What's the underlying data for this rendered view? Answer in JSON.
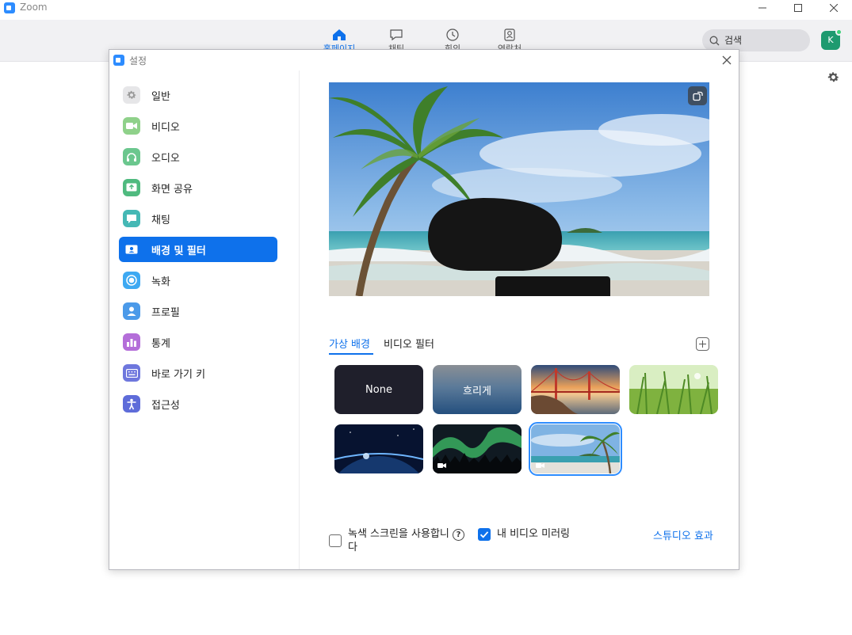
{
  "app": {
    "title": "Zoom"
  },
  "topnav": {
    "tabs": [
      {
        "label": "홈페이지",
        "icon": "home-icon",
        "active": true
      },
      {
        "label": "채팅",
        "icon": "chat-icon",
        "active": false
      },
      {
        "label": "회의",
        "icon": "clock-icon",
        "active": false
      },
      {
        "label": "연락처",
        "icon": "contacts-icon",
        "active": false
      }
    ],
    "search_placeholder": "검색",
    "avatar_initial": "K"
  },
  "settings": {
    "title": "설정",
    "sidebar": [
      {
        "label": "일반",
        "icon": "gear-icon",
        "color": "#9e9e9e"
      },
      {
        "label": "비디오",
        "icon": "video-camera-icon",
        "color": "#7cc576"
      },
      {
        "label": "오디오",
        "icon": "headphones-icon",
        "color": "#66c088"
      },
      {
        "label": "화면 공유",
        "icon": "share-screen-icon",
        "color": "#46b37b"
      },
      {
        "label": "채팅",
        "icon": "chat-bubble-icon",
        "color": "#3fb6b3"
      },
      {
        "label": "배경 및 필터",
        "icon": "person-card-icon",
        "color": "#0e71eb",
        "active": true
      },
      {
        "label": "녹화",
        "icon": "record-icon",
        "color": "#3da7ef"
      },
      {
        "label": "프로필",
        "icon": "profile-icon",
        "color": "#4a98e8"
      },
      {
        "label": "통계",
        "icon": "bar-chart-icon",
        "color": "#b06bd6"
      },
      {
        "label": "바로 가기 키",
        "icon": "keyboard-icon",
        "color": "#6b73d9"
      },
      {
        "label": "접근성",
        "icon": "accessibility-icon",
        "color": "#5d6bd8"
      }
    ],
    "tabs": {
      "virtual_background": "가상 배경",
      "video_filter": "비디오 필터"
    },
    "backgrounds": [
      {
        "label": "None",
        "kind": "none"
      },
      {
        "label": "흐리게",
        "kind": "blur"
      },
      {
        "label": "",
        "kind": "golden-gate"
      },
      {
        "label": "",
        "kind": "grass"
      },
      {
        "label": "",
        "kind": "earth"
      },
      {
        "label": "",
        "kind": "aurora"
      },
      {
        "label": "",
        "kind": "beach",
        "selected": true
      }
    ],
    "green_screen_label": "녹색 스크린을 사용합니다",
    "green_screen_checked": false,
    "mirror_label": "내 비디오 미러링",
    "mirror_checked": true,
    "studio_effects_link": "스튜디오 효과"
  }
}
